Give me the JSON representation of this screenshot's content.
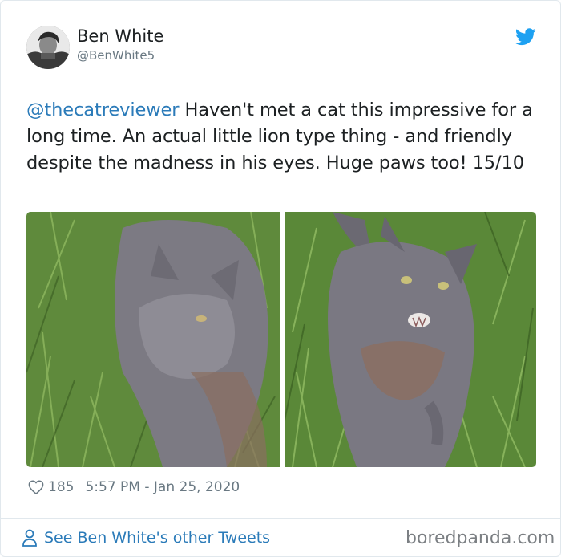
{
  "tweet": {
    "author_name": "Ben White",
    "author_handle": "@BenWhite5",
    "mention": "@thecatreviewer",
    "body": " Haven't met a cat this impressive for a long time. An actual little lion type thing - and friendly despite the madness in his eyes. Huge paws too! 15/10",
    "likes": "185",
    "timestamp": "5:57 PM - Jan 25, 2020",
    "photos": [
      {
        "description": "grey long-haired cat lying in grass, head turned"
      },
      {
        "description": "grey long-haired cat in grass with mouth open"
      }
    ]
  },
  "footer": {
    "link_label": "See Ben White's other Tweets",
    "watermark": "boredpanda.com"
  },
  "icons": {
    "bird": "twitter-bird-icon",
    "heart": "heart-icon",
    "person": "person-icon"
  },
  "colors": {
    "accent": "#2b7bb9",
    "twitter_blue": "#1da1f2",
    "muted": "#697882"
  }
}
